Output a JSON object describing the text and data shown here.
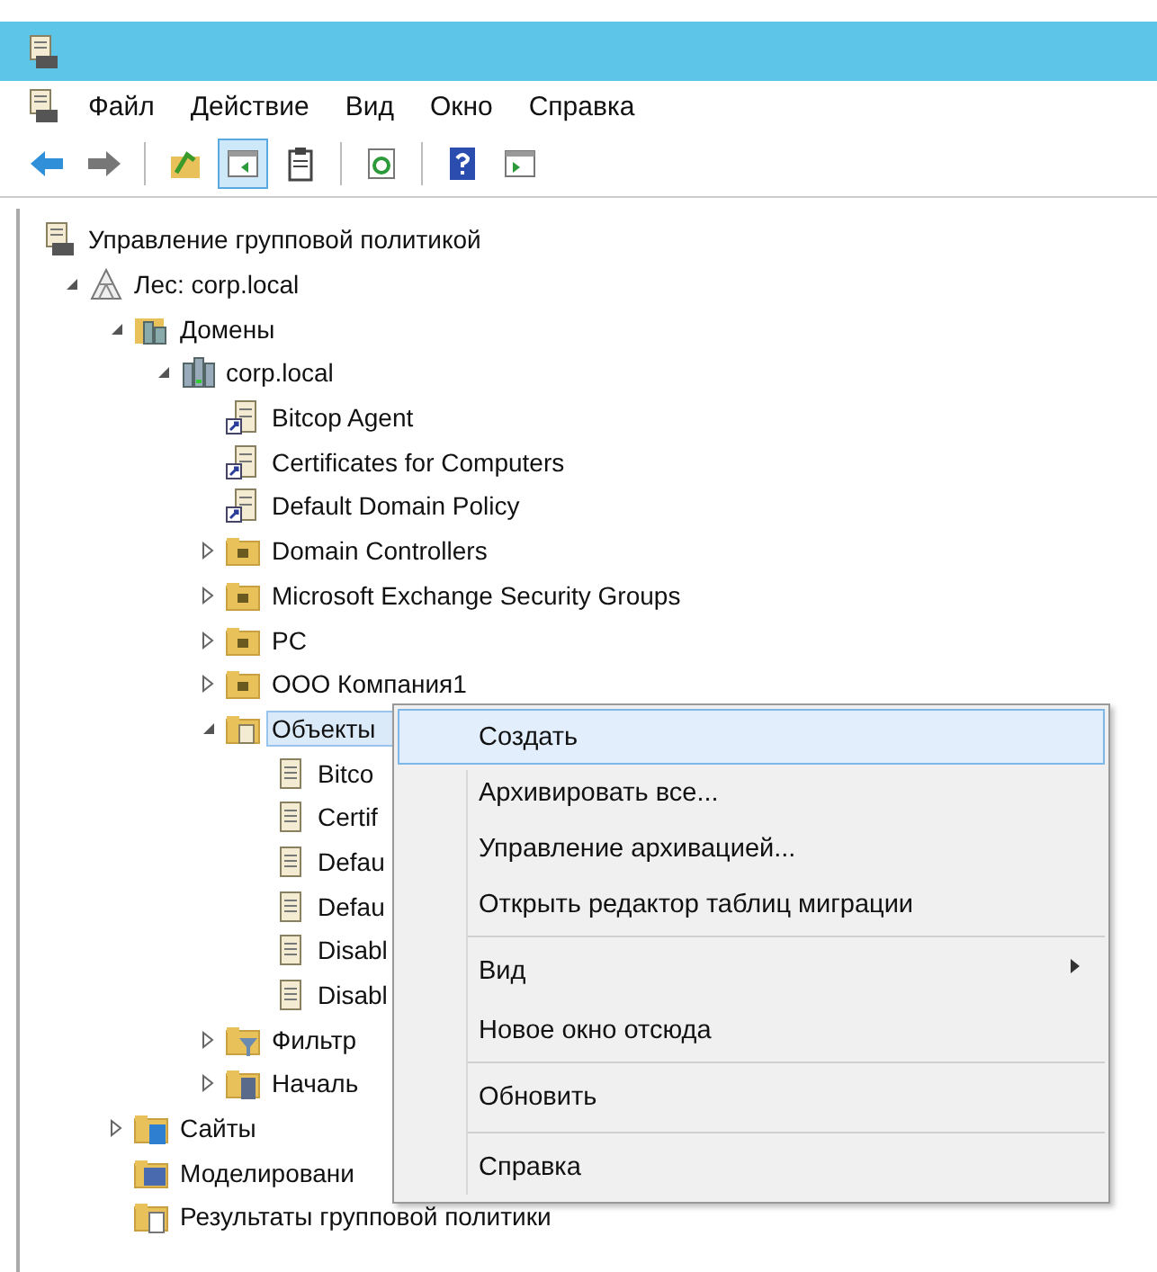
{
  "menu_bar": [
    "Файл",
    "Действие",
    "Вид",
    "Окно",
    "Справка"
  ],
  "toolbar": [
    [
      {
        "kind": "back",
        "selected": false
      },
      {
        "kind": "forward",
        "selected": false
      }
    ],
    [
      {
        "kind": "up",
        "selected": false
      },
      {
        "kind": "tree-toggle",
        "selected": true
      },
      {
        "kind": "clipboard",
        "selected": false
      }
    ],
    [
      {
        "kind": "refresh",
        "selected": false
      }
    ],
    [
      {
        "kind": "help",
        "selected": false
      },
      {
        "kind": "pane",
        "selected": false
      }
    ]
  ],
  "tree": [
    {
      "label": "Управление групповой политикой",
      "kind": "console",
      "selected": false,
      "children": [
        {
          "label": "Лес: corp.local",
          "kind": "forest",
          "expanded": true,
          "selected": false,
          "children": [
            {
              "label": "Домены",
              "kind": "domains",
              "expanded": true,
              "selected": false,
              "children": [
                {
                  "label": "corp.local",
                  "kind": "domain",
                  "expanded": true,
                  "selected": false,
                  "children": [
                    {
                      "label": "Bitcop Agent",
                      "kind": "gpo-link",
                      "selected": false
                    },
                    {
                      "label": "Certificates for Computers",
                      "kind": "gpo-link",
                      "selected": false
                    },
                    {
                      "label": "Default Domain Policy",
                      "kind": "gpo-link",
                      "selected": false
                    },
                    {
                      "label": "Domain Controllers",
                      "kind": "ou",
                      "expanded": false,
                      "selected": false
                    },
                    {
                      "label": "Microsoft Exchange Security Groups",
                      "kind": "ou",
                      "expanded": false,
                      "selected": false
                    },
                    {
                      "label": "PC",
                      "kind": "ou",
                      "expanded": false,
                      "selected": false
                    },
                    {
                      "label": "ООО Компания1",
                      "kind": "ou",
                      "expanded": false,
                      "selected": false
                    },
                    {
                      "label": "Объекты",
                      "kind": "gpo-folder",
                      "expanded": true,
                      "selected": true,
                      "children": [
                        {
                          "label": "Bitco",
                          "kind": "gpo",
                          "selected": false
                        },
                        {
                          "label": "Certif",
                          "kind": "gpo",
                          "selected": false
                        },
                        {
                          "label": "Defau",
                          "kind": "gpo",
                          "selected": false
                        },
                        {
                          "label": "Defau",
                          "kind": "gpo",
                          "selected": false
                        },
                        {
                          "label": "Disabl",
                          "kind": "gpo",
                          "selected": false
                        },
                        {
                          "label": "Disabl",
                          "kind": "gpo",
                          "selected": false
                        }
                      ]
                    },
                    {
                      "label": "Фильтр",
                      "kind": "wmi",
                      "expanded": false,
                      "selected": false
                    },
                    {
                      "label": "Началь",
                      "kind": "starter",
                      "expanded": false,
                      "selected": false
                    }
                  ]
                }
              ]
            },
            {
              "label": "Сайты",
              "kind": "sites",
              "expanded": false,
              "selected": false
            },
            {
              "label": "Моделировани",
              "kind": "modeling",
              "selected": false
            },
            {
              "label": "Результаты групповой политики",
              "kind": "results",
              "selected": false
            }
          ]
        }
      ]
    }
  ],
  "context_menu": [
    {
      "label": "Создать",
      "selected": true,
      "separator_before": false,
      "has_submenu": false
    },
    {
      "label": "Архивировать все...",
      "selected": false,
      "separator_before": false,
      "has_submenu": false
    },
    {
      "label": "Управление архивацией...",
      "selected": false,
      "separator_before": false,
      "has_submenu": false
    },
    {
      "label": "Открыть редактор таблиц миграции",
      "selected": false,
      "separator_before": false,
      "has_submenu": false
    },
    {
      "label": "Вид",
      "selected": false,
      "separator_before": true,
      "has_submenu": true
    },
    {
      "label": "Новое окно отсюда",
      "selected": false,
      "separator_before": false,
      "has_submenu": false
    },
    {
      "label": "Обновить",
      "selected": false,
      "separator_before": true,
      "has_submenu": false
    },
    {
      "label": "Справка",
      "selected": false,
      "separator_before": true,
      "has_submenu": false
    }
  ]
}
